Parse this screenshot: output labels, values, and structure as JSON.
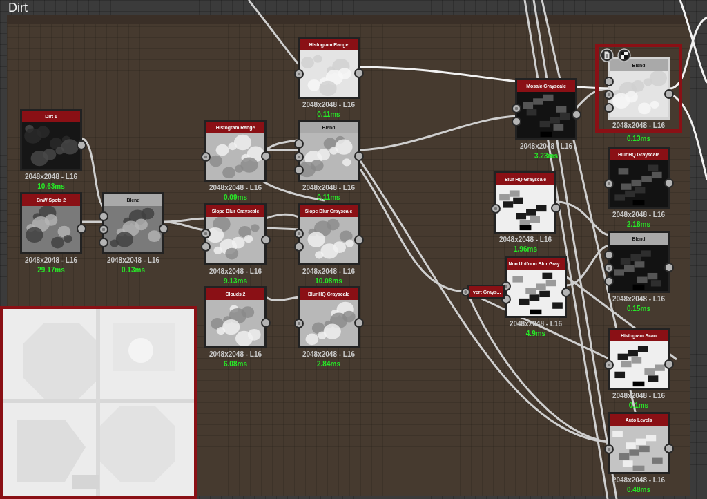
{
  "graph": {
    "title": "Dirt"
  },
  "nodes": [
    {
      "kind": "filter",
      "title": "Dirt 1",
      "selected": false,
      "resolution": "2048x2048 - L16",
      "time": "10.63ms"
    },
    {
      "kind": "filter",
      "title": "BnW Spots 2",
      "selected": false,
      "resolution": "2048x2048 - L16",
      "time": "29.17ms"
    },
    {
      "kind": "blend",
      "title": "Blend",
      "selected": false,
      "inputs": [
        {
          "connected": false
        },
        {
          "connected": true
        },
        {
          "connected": false
        }
      ],
      "resolution": "2048x2048 - L16",
      "time": "0.13ms"
    },
    {
      "kind": "filter",
      "title": "Histogram Range",
      "selected": false,
      "inputs": [
        {
          "connected": true
        }
      ],
      "resolution": "2048x2048 - L16",
      "time": "0.11ms"
    },
    {
      "kind": "filter",
      "title": "Histogram Range",
      "selected": false,
      "inputs": [
        {
          "connected": true
        }
      ],
      "resolution": "2048x2048 - L16",
      "time": "0.09ms"
    },
    {
      "kind": "blend",
      "title": "Blend",
      "selected": false,
      "inputs": [
        {
          "connected": false
        },
        {
          "connected": true
        },
        {
          "connected": false
        }
      ],
      "resolution": "2048x2048 - L16",
      "time": "0.11ms"
    },
    {
      "kind": "filter",
      "title": "Slope Blur Grayscale",
      "selected": false,
      "inputs": [
        {
          "connected": true
        },
        {
          "connected": false
        }
      ],
      "resolution": "2048x2048 - L16",
      "time": "9.13ms"
    },
    {
      "kind": "filter",
      "title": "Slope Blur Grayscale",
      "selected": false,
      "inputs": [
        {
          "connected": true
        },
        {
          "connected": false
        }
      ],
      "resolution": "2048x2048 - L16",
      "time": "10.08ms"
    },
    {
      "kind": "filter",
      "title": "Clouds 2",
      "selected": false,
      "resolution": "2048x2048 - L16",
      "time": "6.08ms"
    },
    {
      "kind": "filter",
      "title": "Blur HQ Grayscale",
      "selected": false,
      "inputs": [
        {
          "connected": true
        }
      ],
      "resolution": "2048x2048 - L16",
      "time": "2.84ms"
    },
    {
      "kind": "filter",
      "title": "Mosaic Grayscale",
      "selected": false,
      "inputs": [
        {
          "connected": true
        },
        {
          "connected": false
        }
      ],
      "resolution": "2048x2048 - L16",
      "time": "3.23ms"
    },
    {
      "kind": "blend",
      "title": "Blend",
      "selected": true,
      "inputs": [
        {
          "connected": false
        },
        {
          "connected": true
        },
        {
          "connected": false
        }
      ],
      "resolution": "2048x2048 - L16",
      "time": "0.13ms"
    },
    {
      "kind": "filter",
      "title": "Blur HQ Grayscale",
      "selected": false,
      "inputs": [
        {
          "connected": true
        }
      ],
      "resolution": "2048x2048 - L16",
      "time": "2.18ms"
    },
    {
      "kind": "filter",
      "title": "Blur HQ Grayscale",
      "selected": false,
      "inputs": [
        {
          "connected": true
        }
      ],
      "resolution": "2048x2048 - L16",
      "time": "1.96ms"
    },
    {
      "kind": "blend",
      "title": "Blend",
      "selected": false,
      "inputs": [
        {
          "connected": false
        },
        {
          "connected": true
        },
        {
          "connected": false
        }
      ],
      "resolution": "2048x2048 - L16",
      "time": "0.15ms"
    },
    {
      "kind": "filter",
      "title": "Non Uniform Blur Gray...",
      "selected": false,
      "inputs": [
        {
          "connected": true
        },
        {
          "connected": false
        }
      ],
      "resolution": "2048x2048 - L16",
      "time": "4.9ms"
    },
    {
      "kind": "stub",
      "title": "vert Grays...",
      "inputs": [
        {
          "connected": true
        }
      ]
    },
    {
      "kind": "filter",
      "title": "Histogram Scan",
      "selected": false,
      "inputs": [
        {
          "connected": true
        }
      ],
      "resolution": "2048x2048 - L16",
      "time": "0.1ms"
    },
    {
      "kind": "filter",
      "title": "Auto Levels",
      "selected": false,
      "inputs": [
        {
          "connected": true
        }
      ],
      "resolution": "2048x2048 - L16",
      "time": "0.48ms"
    }
  ]
}
